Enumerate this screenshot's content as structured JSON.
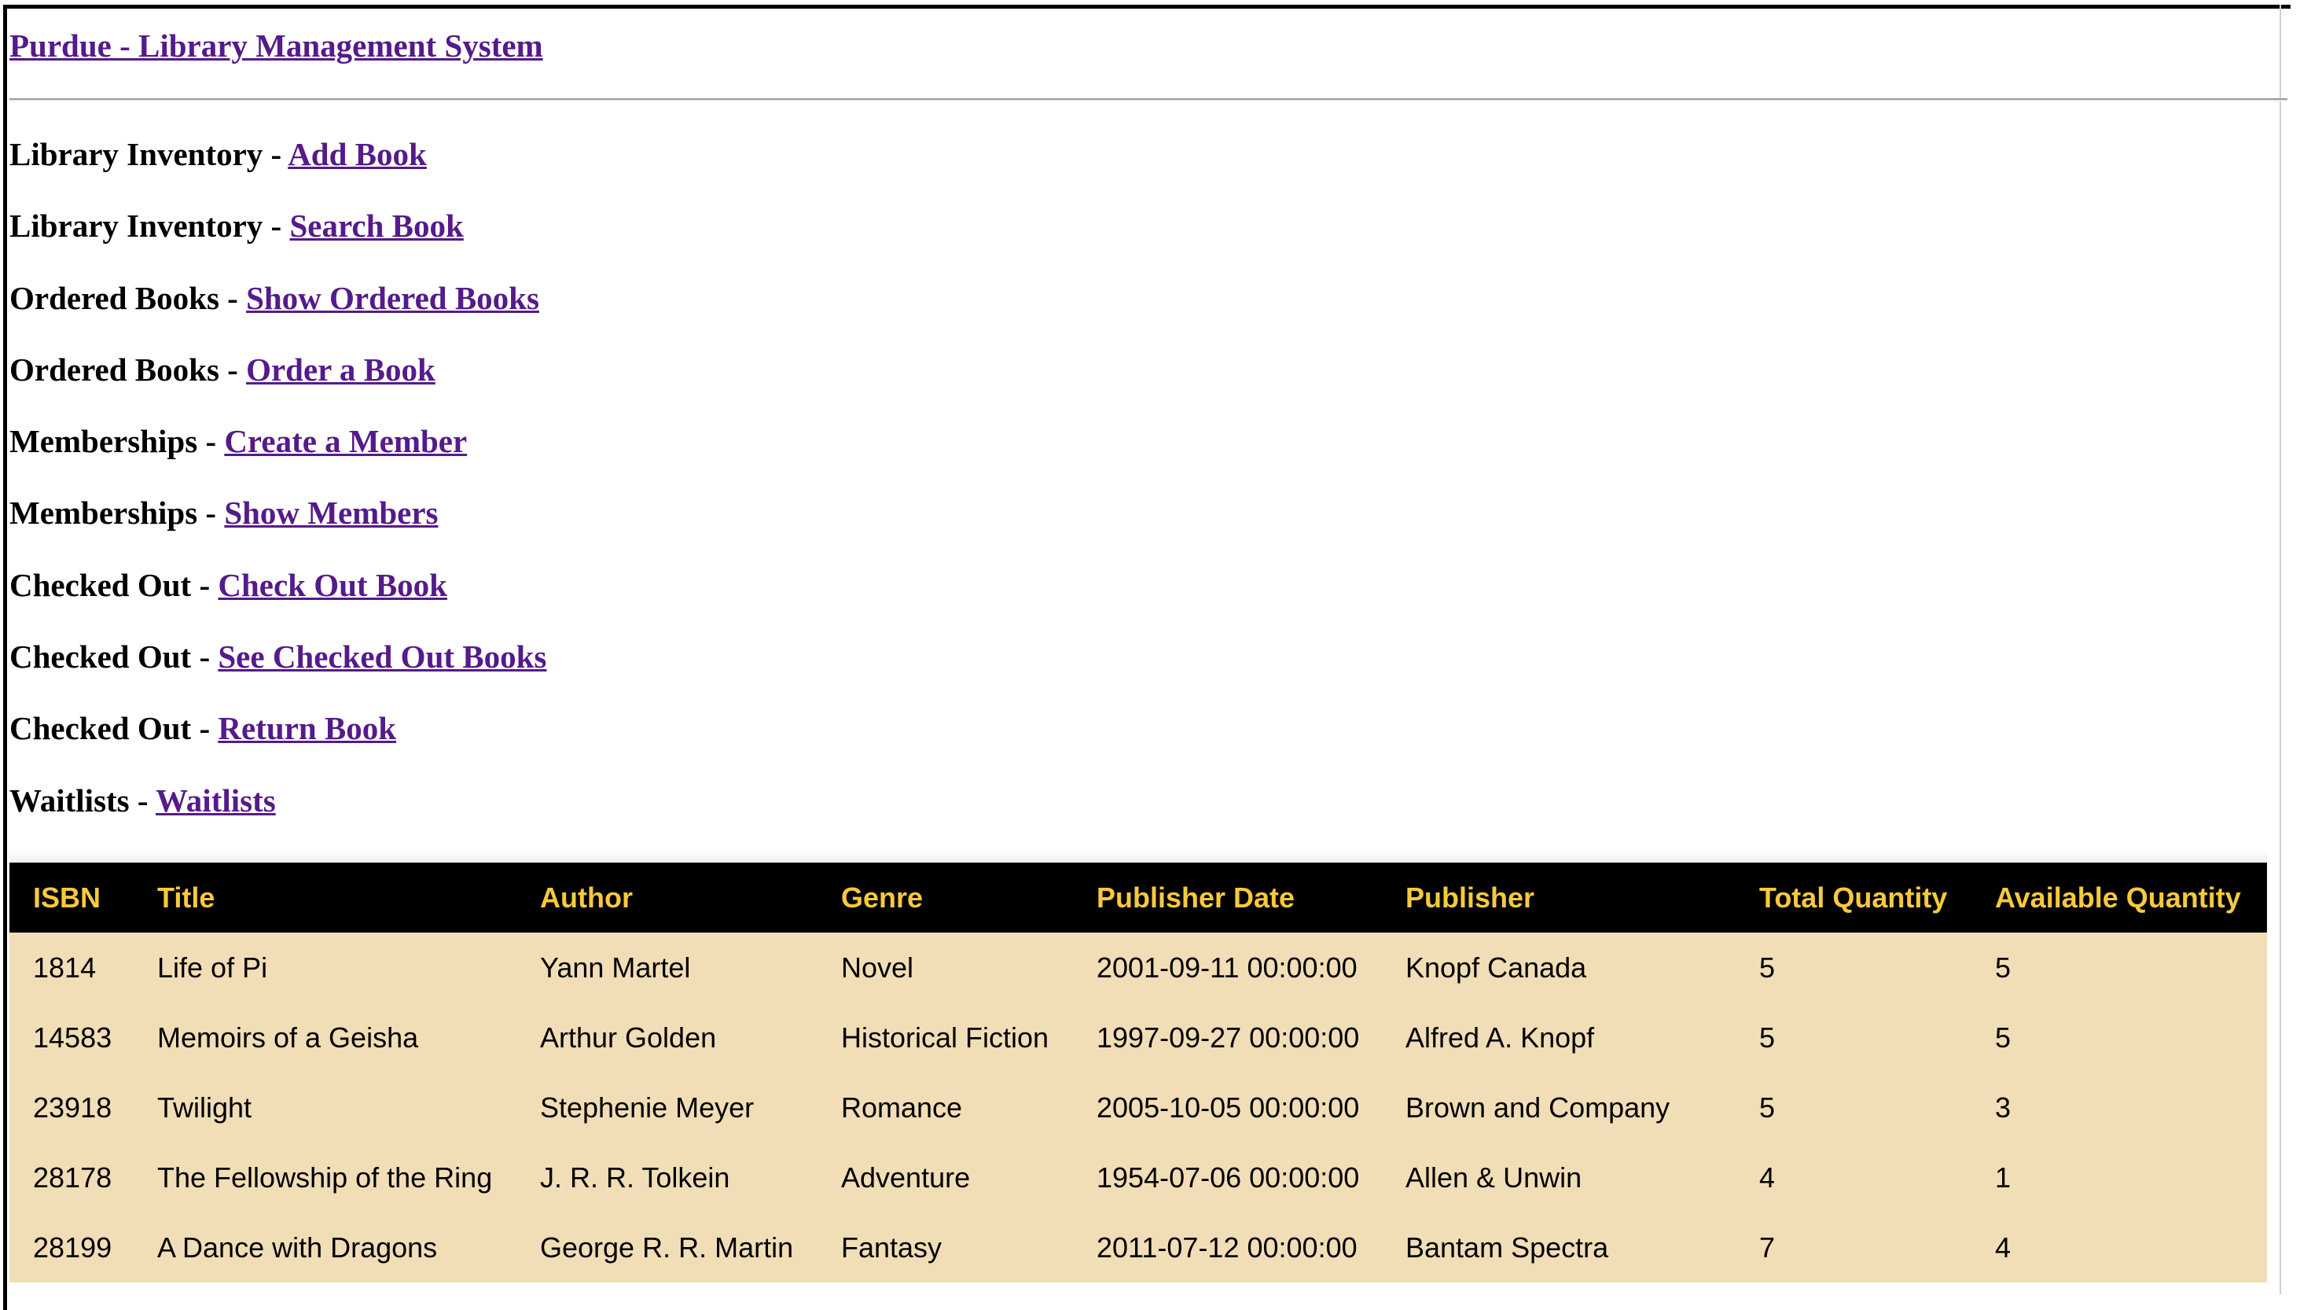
{
  "header": {
    "title": "Purdue - Library Management System"
  },
  "nav": [
    {
      "section": "Library Inventory",
      "link": "Add Book"
    },
    {
      "section": "Library Inventory",
      "link": "Search Book"
    },
    {
      "section": "Ordered Books",
      "link": "Show Ordered Books"
    },
    {
      "section": "Ordered Books",
      "link": "Order a Book"
    },
    {
      "section": "Memberships",
      "link": "Create a Member"
    },
    {
      "section": "Memberships",
      "link": "Show Members"
    },
    {
      "section": "Checked Out",
      "link": "Check Out Book"
    },
    {
      "section": "Checked Out",
      "link": "See Checked Out Books"
    },
    {
      "section": "Checked Out",
      "link": "Return Book"
    },
    {
      "section": "Waitlists",
      "link": "Waitlists"
    }
  ],
  "separator": " - ",
  "table": {
    "columns": [
      "ISBN",
      "Title",
      "Author",
      "Genre",
      "Publisher Date",
      "Publisher",
      "Total Quantity",
      "Available Quantity"
    ],
    "rows": [
      [
        "1814",
        "Life of Pi",
        "Yann Martel",
        "Novel",
        "2001-09-11 00:00:00",
        "Knopf Canada",
        "5",
        "5"
      ],
      [
        "14583",
        "Memoirs of a Geisha",
        "Arthur Golden",
        "Historical Fiction",
        "1997-09-27 00:00:00",
        "Alfred A. Knopf",
        "5",
        "5"
      ],
      [
        "23918",
        "Twilight",
        "Stephenie Meyer",
        "Romance",
        "2005-10-05 00:00:00",
        "Brown and Company",
        "5",
        "3"
      ],
      [
        "28178",
        "The Fellowship of the Ring",
        "J. R. R. Tolkein",
        "Adventure",
        "1954-07-06 00:00:00",
        "Allen & Unwin",
        "4",
        "1"
      ],
      [
        "28199",
        "A Dance with Dragons",
        "George R. R. Martin",
        "Fantasy",
        "2011-07-12 00:00:00",
        "Bantam Spectra",
        "7",
        "4"
      ]
    ]
  },
  "colors": {
    "link": "#551A8B",
    "header_bg": "#000000",
    "header_text": "#f7c93c",
    "row_bg": "#f1deb6"
  }
}
